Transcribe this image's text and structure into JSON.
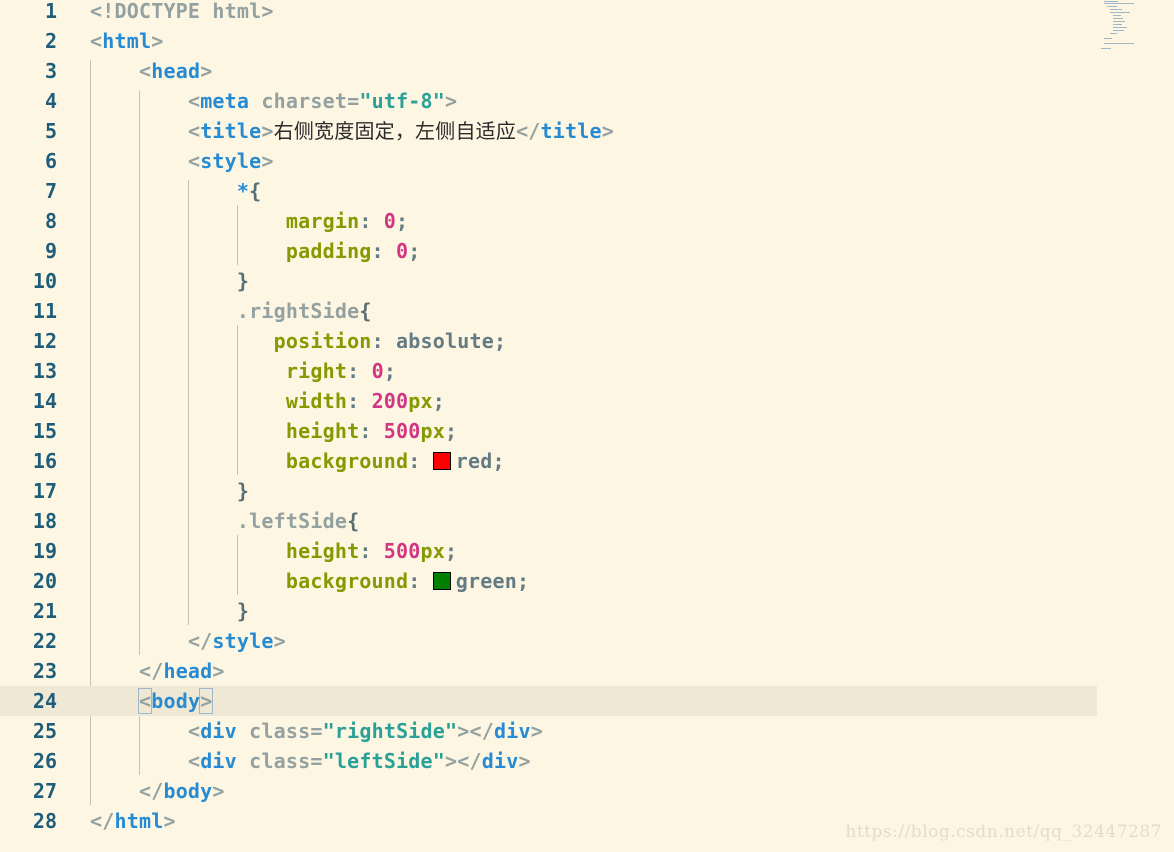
{
  "editor": {
    "current_line": 24,
    "lines": [
      {
        "n": "1",
        "tokens": [
          {
            "t": "<!DOCTYPE",
            "c": "t-dim"
          },
          {
            "t": " html",
            "c": "t-dim"
          },
          {
            "t": ">",
            "c": "t-dim"
          }
        ]
      },
      {
        "n": "2",
        "tokens": [
          {
            "t": "<",
            "c": "t-punct"
          },
          {
            "t": "html",
            "c": "t-tag"
          },
          {
            "t": ">",
            "c": "t-punct"
          }
        ]
      },
      {
        "n": "3",
        "tokens": [
          {
            "t": "    "
          },
          {
            "t": "<",
            "c": "t-punct"
          },
          {
            "t": "head",
            "c": "t-tag"
          },
          {
            "t": ">",
            "c": "t-punct"
          }
        ]
      },
      {
        "n": "4",
        "tokens": [
          {
            "t": "        "
          },
          {
            "t": "<",
            "c": "t-punct"
          },
          {
            "t": "meta",
            "c": "t-tag"
          },
          {
            "t": " charset",
            "c": "t-attr"
          },
          {
            "t": "=",
            "c": "t-punct"
          },
          {
            "t": "\"utf-8\"",
            "c": "t-str"
          },
          {
            "t": ">",
            "c": "t-punct"
          }
        ]
      },
      {
        "n": "5",
        "tokens": [
          {
            "t": "        "
          },
          {
            "t": "<",
            "c": "t-punct"
          },
          {
            "t": "title",
            "c": "t-tag"
          },
          {
            "t": ">",
            "c": "t-punct"
          },
          {
            "t": "右侧宽度固定，左侧自适应",
            "c": "t-text"
          },
          {
            "t": "</",
            "c": "t-punct"
          },
          {
            "t": "title",
            "c": "t-tag"
          },
          {
            "t": ">",
            "c": "t-punct"
          }
        ]
      },
      {
        "n": "6",
        "tokens": [
          {
            "t": "        "
          },
          {
            "t": "<",
            "c": "t-punct"
          },
          {
            "t": "style",
            "c": "t-tag"
          },
          {
            "t": ">",
            "c": "t-punct"
          }
        ]
      },
      {
        "n": "7",
        "tokens": [
          {
            "t": "            "
          },
          {
            "t": "*",
            "c": "t-tag"
          },
          {
            "t": "{",
            "c": "t-brace"
          }
        ]
      },
      {
        "n": "8",
        "tokens": [
          {
            "t": "                "
          },
          {
            "t": "margin",
            "c": "t-prop"
          },
          {
            "t": ": ",
            "c": "t-val"
          },
          {
            "t": "0",
            "c": "t-num"
          },
          {
            "t": ";",
            "c": "t-val"
          }
        ]
      },
      {
        "n": "9",
        "tokens": [
          {
            "t": "                "
          },
          {
            "t": "padding",
            "c": "t-prop"
          },
          {
            "t": ": ",
            "c": "t-val"
          },
          {
            "t": "0",
            "c": "t-num"
          },
          {
            "t": ";",
            "c": "t-val"
          }
        ]
      },
      {
        "n": "10",
        "tokens": [
          {
            "t": "            "
          },
          {
            "t": "}",
            "c": "t-brace"
          }
        ]
      },
      {
        "n": "11",
        "tokens": [
          {
            "t": "            "
          },
          {
            "t": ".rightSide",
            "c": "t-sel"
          },
          {
            "t": "{",
            "c": "t-brace"
          }
        ]
      },
      {
        "n": "12",
        "tokens": [
          {
            "t": "               "
          },
          {
            "t": "position",
            "c": "t-prop"
          },
          {
            "t": ": ",
            "c": "t-val"
          },
          {
            "t": "absolute",
            "c": "t-val"
          },
          {
            "t": ";",
            "c": "t-val"
          }
        ]
      },
      {
        "n": "13",
        "tokens": [
          {
            "t": "                "
          },
          {
            "t": "right",
            "c": "t-prop"
          },
          {
            "t": ": ",
            "c": "t-val"
          },
          {
            "t": "0",
            "c": "t-num"
          },
          {
            "t": ";",
            "c": "t-val"
          }
        ]
      },
      {
        "n": "14",
        "tokens": [
          {
            "t": "                "
          },
          {
            "t": "width",
            "c": "t-prop"
          },
          {
            "t": ": ",
            "c": "t-val"
          },
          {
            "t": "200",
            "c": "t-num"
          },
          {
            "t": "px",
            "c": "t-prop"
          },
          {
            "t": ";",
            "c": "t-val"
          }
        ]
      },
      {
        "n": "15",
        "tokens": [
          {
            "t": "                "
          },
          {
            "t": "height",
            "c": "t-prop"
          },
          {
            "t": ": ",
            "c": "t-val"
          },
          {
            "t": "500",
            "c": "t-num"
          },
          {
            "t": "px",
            "c": "t-prop"
          },
          {
            "t": ";",
            "c": "t-val"
          }
        ]
      },
      {
        "n": "16",
        "tokens": [
          {
            "t": "                "
          },
          {
            "t": "background",
            "c": "t-prop"
          },
          {
            "t": ": ",
            "c": "t-val"
          },
          {
            "swatch": "#ff0000"
          },
          {
            "t": "red",
            "c": "t-val"
          },
          {
            "t": ";",
            "c": "t-val"
          }
        ]
      },
      {
        "n": "17",
        "tokens": [
          {
            "t": "            "
          },
          {
            "t": "}",
            "c": "t-brace"
          }
        ]
      },
      {
        "n": "18",
        "tokens": [
          {
            "t": "            "
          },
          {
            "t": ".leftSide",
            "c": "t-sel"
          },
          {
            "t": "{",
            "c": "t-brace"
          }
        ]
      },
      {
        "n": "19",
        "tokens": [
          {
            "t": "                "
          },
          {
            "t": "height",
            "c": "t-prop"
          },
          {
            "t": ": ",
            "c": "t-val"
          },
          {
            "t": "500",
            "c": "t-num"
          },
          {
            "t": "px",
            "c": "t-prop"
          },
          {
            "t": ";",
            "c": "t-val"
          }
        ]
      },
      {
        "n": "20",
        "tokens": [
          {
            "t": "                "
          },
          {
            "t": "background",
            "c": "t-prop"
          },
          {
            "t": ": ",
            "c": "t-val"
          },
          {
            "swatch": "#008000"
          },
          {
            "t": "green",
            "c": "t-val"
          },
          {
            "t": ";",
            "c": "t-val"
          }
        ]
      },
      {
        "n": "21",
        "tokens": [
          {
            "t": "            "
          },
          {
            "t": "}",
            "c": "t-brace"
          }
        ]
      },
      {
        "n": "22",
        "tokens": [
          {
            "t": "        "
          },
          {
            "t": "</",
            "c": "t-punct"
          },
          {
            "t": "style",
            "c": "t-tag"
          },
          {
            "t": ">",
            "c": "t-punct"
          }
        ]
      },
      {
        "n": "23",
        "tokens": [
          {
            "t": "    "
          },
          {
            "t": "</",
            "c": "t-punct"
          },
          {
            "t": "head",
            "c": "t-tag"
          },
          {
            "t": ">",
            "c": "t-punct"
          }
        ]
      },
      {
        "n": "24",
        "tokens": [
          {
            "t": "    "
          },
          {
            "t": "<",
            "c": "t-punct bracket-box"
          },
          {
            "t": "body",
            "c": "t-tag"
          },
          {
            "t": ">",
            "c": "t-punct bracket-box"
          }
        ]
      },
      {
        "n": "25",
        "tokens": [
          {
            "t": "        "
          },
          {
            "t": "<",
            "c": "t-punct"
          },
          {
            "t": "div",
            "c": "t-tag"
          },
          {
            "t": " class",
            "c": "t-attr"
          },
          {
            "t": "=",
            "c": "t-punct"
          },
          {
            "t": "\"rightSide\"",
            "c": "t-str"
          },
          {
            "t": "></",
            "c": "t-punct"
          },
          {
            "t": "div",
            "c": "t-tag"
          },
          {
            "t": ">",
            "c": "t-punct"
          }
        ]
      },
      {
        "n": "26",
        "tokens": [
          {
            "t": "        "
          },
          {
            "t": "<",
            "c": "t-punct"
          },
          {
            "t": "div",
            "c": "t-tag"
          },
          {
            "t": " class",
            "c": "t-attr"
          },
          {
            "t": "=",
            "c": "t-punct"
          },
          {
            "t": "\"leftSide\"",
            "c": "t-str"
          },
          {
            "t": "></",
            "c": "t-punct"
          },
          {
            "t": "div",
            "c": "t-tag"
          },
          {
            "t": ">",
            "c": "t-punct"
          }
        ]
      },
      {
        "n": "27",
        "tokens": [
          {
            "t": "    "
          },
          {
            "t": "</",
            "c": "t-punct"
          },
          {
            "t": "body",
            "c": "t-tag"
          },
          {
            "t": ">",
            "c": "t-punct"
          }
        ]
      },
      {
        "n": "28",
        "tokens": [
          {
            "t": "</",
            "c": "t-punct"
          },
          {
            "t": "html",
            "c": "t-tag"
          },
          {
            "t": ">",
            "c": "t-punct"
          }
        ]
      }
    ]
  },
  "watermark": "https://blog.csdn.net/qq_32447287",
  "colors": {
    "background": "#fdf6e3",
    "current_line": "#eee8d5",
    "line_number": "#1f5e7a",
    "tag": "#268bd2",
    "string": "#2aa198",
    "property": "#859900",
    "number": "#d33682"
  }
}
